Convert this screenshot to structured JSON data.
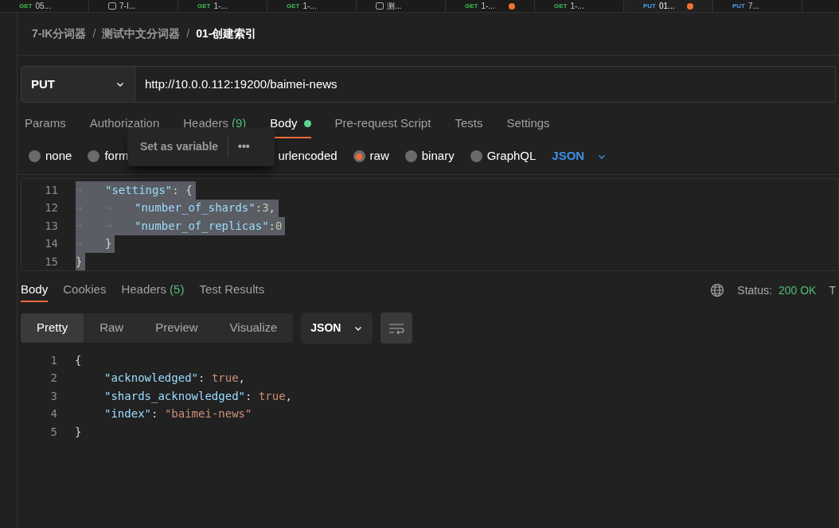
{
  "open_tabs": [
    {
      "kind": "request",
      "method": "GET",
      "name": "05...",
      "unsaved": false,
      "selected": false
    },
    {
      "kind": "folder",
      "name": "7-I...",
      "unsaved": false,
      "selected": false
    },
    {
      "kind": "request",
      "method": "GET",
      "name": "1-...",
      "unsaved": false,
      "selected": false
    },
    {
      "kind": "request",
      "method": "GET",
      "name": "1-...",
      "unsaved": false,
      "selected": false
    },
    {
      "kind": "folder",
      "name": "测...",
      "unsaved": false,
      "selected": false
    },
    {
      "kind": "request",
      "method": "GET",
      "name": "1-...",
      "unsaved": true,
      "selected": false
    },
    {
      "kind": "request",
      "method": "GET",
      "name": "1-...",
      "unsaved": false,
      "selected": false
    },
    {
      "kind": "request",
      "method": "PUT",
      "name": "01...",
      "unsaved": true,
      "selected": true
    },
    {
      "kind": "request",
      "method": "PUT",
      "name": "7...",
      "unsaved": false,
      "selected": false
    }
  ],
  "breadcrumb": [
    {
      "kind": "item",
      "text": "7-IK分词器"
    },
    {
      "kind": "separator",
      "text": "/"
    },
    {
      "kind": "item",
      "text": "测试中文分词器"
    },
    {
      "kind": "separator",
      "text": "/"
    },
    {
      "kind": "current",
      "text": "01-创建索引"
    }
  ],
  "request": {
    "method": "PUT",
    "url": "http://10.0.0.112:19200/baimei-news"
  },
  "request_tabs": [
    {
      "label": "Params",
      "selected": false
    },
    {
      "label": "Authorization",
      "selected": false
    },
    {
      "label": "Headers",
      "count": "(9)",
      "selected": false
    },
    {
      "label": "Body",
      "dot": true,
      "selected": true
    },
    {
      "label": "Pre-request Script",
      "selected": false
    },
    {
      "label": "Tests",
      "selected": false
    },
    {
      "label": "Settings",
      "selected": false
    }
  ],
  "body_types": [
    {
      "kind": "radio",
      "label": "none",
      "selected": false
    },
    {
      "kind": "radio",
      "label": "form",
      "selected": false
    },
    {
      "kind": "text",
      "label": "urlencoded"
    },
    {
      "kind": "radio",
      "label": "raw",
      "selected": true
    },
    {
      "kind": "radio",
      "label": "binary",
      "selected": false
    },
    {
      "kind": "radio",
      "label": "GraphQL",
      "selected": false
    }
  ],
  "body_format": "JSON",
  "popup": {
    "label": "Set as variable",
    "more": "•••"
  },
  "request_code": [
    {
      "number": "11",
      "selected": true,
      "tokens": [
        {
          "kind": "indent"
        },
        {
          "kind": "key",
          "text": "\"settings\""
        },
        {
          "kind": "punct",
          "text": ": {"
        }
      ]
    },
    {
      "number": "12",
      "selected": true,
      "tokens": [
        {
          "kind": "indent"
        },
        {
          "kind": "indent"
        },
        {
          "kind": "key",
          "text": "\"number_of_shards\""
        },
        {
          "kind": "punct",
          "text": ":"
        },
        {
          "kind": "num",
          "text": "3"
        },
        {
          "kind": "punct",
          "text": ","
        }
      ]
    },
    {
      "number": "13",
      "selected": true,
      "tokens": [
        {
          "kind": "indent"
        },
        {
          "kind": "indent"
        },
        {
          "kind": "key",
          "text": "\"number_of_replicas\""
        },
        {
          "kind": "punct",
          "text": ":"
        },
        {
          "kind": "num",
          "text": "0"
        }
      ]
    },
    {
      "number": "14",
      "selected": true,
      "tokens": [
        {
          "kind": "indent"
        },
        {
          "kind": "punct",
          "text": "}"
        }
      ]
    },
    {
      "number": "15",
      "selected": true,
      "tokens": [
        {
          "kind": "punct",
          "text": "}"
        }
      ]
    }
  ],
  "response_tabs": [
    {
      "label": "Body",
      "selected": true
    },
    {
      "label": "Cookies",
      "selected": false
    },
    {
      "label": "Headers",
      "count": "(5)",
      "selected": false
    },
    {
      "label": "Test Results",
      "selected": false
    }
  ],
  "status": {
    "label": "Status:",
    "value": "200 OK",
    "extra": "T"
  },
  "view_modes": [
    {
      "label": "Pretty",
      "selected": true
    },
    {
      "label": "Raw",
      "selected": false
    },
    {
      "label": "Preview",
      "selected": false
    },
    {
      "label": "Visualize",
      "selected": false
    }
  ],
  "response_format": "JSON",
  "response_code": [
    {
      "number": "1",
      "tokens": [
        {
          "kind": "punct",
          "text": "{"
        }
      ]
    },
    {
      "number": "2",
      "tokens": [
        {
          "kind": "indent"
        },
        {
          "kind": "key",
          "text": "\"acknowledged\""
        },
        {
          "kind": "punct",
          "text": ": "
        },
        {
          "kind": "bool",
          "text": "true"
        },
        {
          "kind": "punct",
          "text": ","
        }
      ]
    },
    {
      "number": "3",
      "tokens": [
        {
          "kind": "indent"
        },
        {
          "kind": "key",
          "text": "\"shards_acknowledged\""
        },
        {
          "kind": "punct",
          "text": ": "
        },
        {
          "kind": "bool",
          "text": "true"
        },
        {
          "kind": "punct",
          "text": ","
        }
      ]
    },
    {
      "number": "4",
      "tokens": [
        {
          "kind": "indent"
        },
        {
          "kind": "key",
          "text": "\"index\""
        },
        {
          "kind": "punct",
          "text": ": "
        },
        {
          "kind": "str",
          "text": "\"baimei-news\""
        }
      ]
    },
    {
      "number": "5",
      "tokens": [
        {
          "kind": "punct",
          "text": "}"
        }
      ]
    }
  ]
}
